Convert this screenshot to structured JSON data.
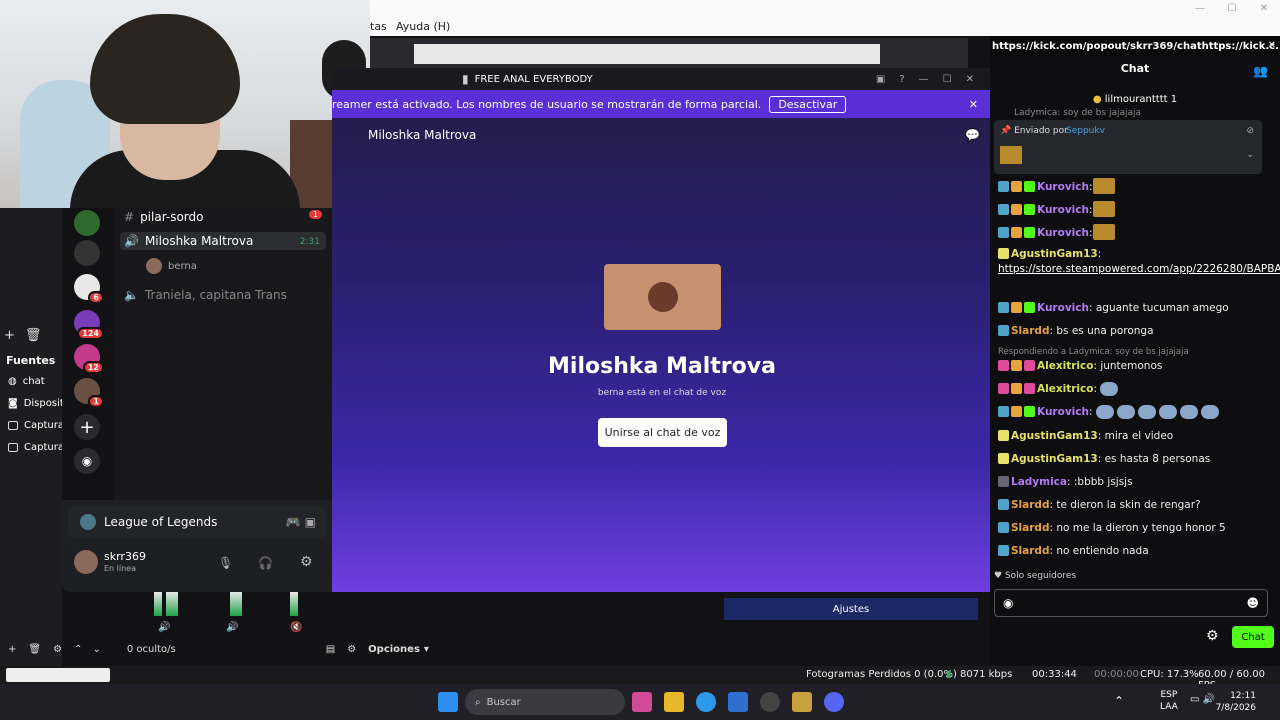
{
  "obs": {
    "menu_partial": "tas",
    "menu_help": "Ayuda (H)",
    "fuentes_title": "Fuentes",
    "sources": [
      "chat",
      "Disposit",
      "Captura",
      "Captura"
    ],
    "hidden_count": "0 oculto/s",
    "options": "Opciones",
    "settings": "Ajustes",
    "status": {
      "dropped": "Fotogramas Perdidos 0 (0.0%)",
      "bitrate": "8071 kbps",
      "live_time": "00:33:44",
      "rec_time": "00:00:00",
      "cpu": "CPU: 17.3%",
      "fps": "60.00 / 60.00 FPS"
    },
    "mixer_db": [
      "-48",
      "-54",
      "-60"
    ]
  },
  "discord": {
    "window_title": "FREE ANAL EVERYBODY",
    "banner_text": "reamer está activado. Los nombres de usuario se mostrarán de forma parcial.",
    "banner_button": "Desactivar",
    "channel_title": "Miloshka Maltrova",
    "big_name": "Miloshka Maltrova",
    "sub_text": "berna está en el chat de voz",
    "join_button": "Unirse al chat de voz",
    "channels": [
      {
        "name": "pilar-sordo",
        "badge": "1"
      },
      {
        "name": "Miloshka Maltrova",
        "time": "2:31"
      },
      {
        "name": "berna"
      },
      {
        "name": "Traniela, capitana Trans"
      }
    ],
    "server_badges": [
      "6",
      "124",
      "12",
      "1"
    ],
    "game": "League of Legends",
    "user": {
      "name": "skrr369",
      "status": "En línea"
    }
  },
  "chat": {
    "url": "https://kick.com/popout/skrr369/chathttps://kick.c...",
    "header": "Chat",
    "gift_line": "lilmourantttt 1",
    "top_partial": "Ladymica: soy de bs jajajaja",
    "pinned_by_label": "Enviado por",
    "pinned_by_user": "Seppukv",
    "messages": [
      {
        "user": "Kurovich",
        "color": "#b57af7",
        "text": ":"
      },
      {
        "user": "Kurovich",
        "color": "#b57af7",
        "text": ":"
      },
      {
        "user": "Kurovich",
        "color": "#b57af7",
        "text": ":"
      },
      {
        "user": "AgustinGam13",
        "color": "#e8e26a",
        "text": ":"
      },
      {
        "user": "Kurovich",
        "color": "#b57af7",
        "text": ": aguante tucuman amego"
      },
      {
        "user": "Slardd",
        "color": "#e6a23c",
        "text": ": bs es una poronga"
      },
      {
        "user": "Alexitrico",
        "color": "#d8e256",
        "text": ": juntemonos"
      },
      {
        "user": "Alexitrico",
        "color": "#d8e256",
        "text": ":"
      },
      {
        "user": "Kurovich",
        "color": "#b57af7",
        "text": ":"
      },
      {
        "user": "AgustinGam13",
        "color": "#e8e26a",
        "text": ": mira el video"
      },
      {
        "user": "AgustinGam13",
        "color": "#e8e26a",
        "text": ": es hasta 8 personas"
      },
      {
        "user": "Ladymica",
        "color": "#b57af7",
        "text": ": :bbbb jsjsjs"
      },
      {
        "user": "Slardd",
        "color": "#e6a23c",
        "text": ": te dieron la skin de rengar?"
      },
      {
        "user": "Slardd",
        "color": "#e6a23c",
        "text": ": no me la dieron y tengo honor 5"
      },
      {
        "user": "Slardd",
        "color": "#e6a23c",
        "text": ": no entiendo nada"
      }
    ],
    "link": "https://store.steampowered.com/app/2226280/BAPBAP/",
    "reply_line": "Respondiendo a Ladymica: soy de bs jajajaja",
    "mode": "Solo seguidores",
    "send": "Chat"
  },
  "taskbar": {
    "search_placeholder": "Buscar",
    "lang": "ESP",
    "lang2": "LAA",
    "time": "12:11",
    "date": "7/8/2026"
  }
}
